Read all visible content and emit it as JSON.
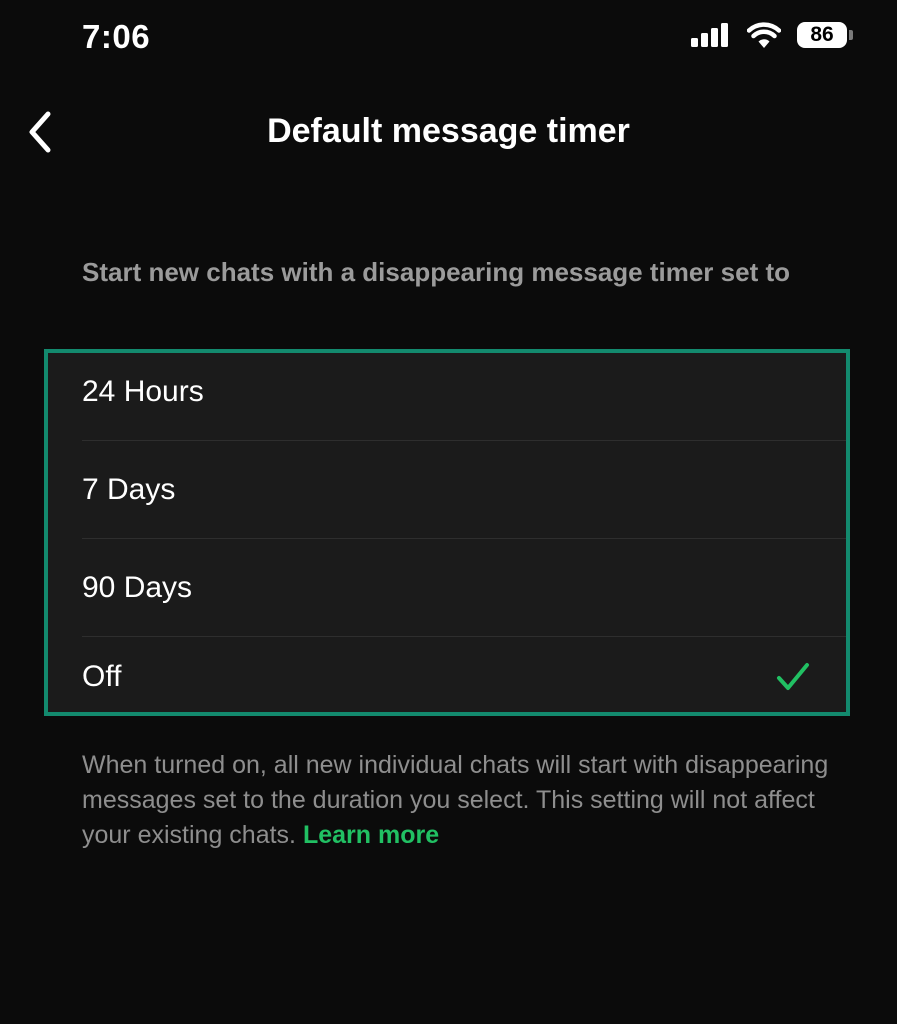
{
  "status_bar": {
    "time": "7:06",
    "battery_level": "86",
    "icons": [
      "signal-icon",
      "wifi-icon",
      "battery-icon"
    ]
  },
  "nav": {
    "back_icon": "chevron-left-icon",
    "title": "Default message timer"
  },
  "section_header": "Start new chats with a disappearing message timer set to",
  "options": [
    {
      "label": "24 Hours",
      "selected": false
    },
    {
      "label": "7 Days",
      "selected": false
    },
    {
      "label": "90 Days",
      "selected": false
    },
    {
      "label": "Off",
      "selected": true
    }
  ],
  "footer": {
    "text": "When turned on, all new individual chats will start with disappearing messages set to the duration you select. This setting will not affect your existing chats. ",
    "link": "Learn more"
  },
  "colors": {
    "background": "#0b0b0b",
    "card": "#1b1b1b",
    "accent": "#21c063",
    "highlight_border": "#138a6e"
  }
}
